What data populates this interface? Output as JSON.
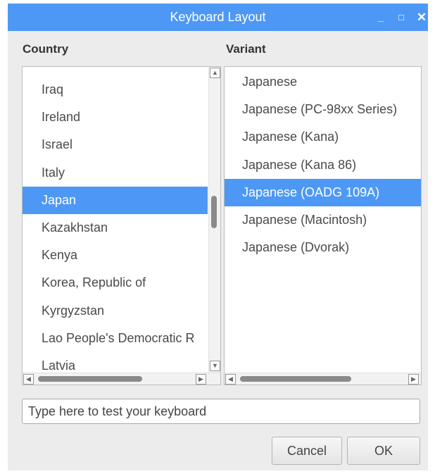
{
  "window": {
    "title": "Keyboard Layout",
    "minimize_glyph": "_",
    "maximize_glyph": "□",
    "close_glyph": "✕"
  },
  "country": {
    "label": "Country",
    "items": [
      "Iraq",
      "Ireland",
      "Israel",
      "Italy",
      "Japan",
      "Kazakhstan",
      "Kenya",
      "Korea, Republic of",
      "Kyrgyzstan",
      "Lao People's Democratic R",
      "Latvia"
    ],
    "selected_index": 4
  },
  "variant": {
    "label": "Variant",
    "items": [
      "Japanese",
      "Japanese (PC-98xx Series)",
      "Japanese (Kana)",
      "Japanese (Kana 86)",
      "Japanese (OADG 109A)",
      "Japanese (Macintosh)",
      "Japanese (Dvorak)"
    ],
    "selected_index": 4
  },
  "test_input": {
    "placeholder": "Type here to test your keyboard",
    "value": ""
  },
  "buttons": {
    "cancel": "Cancel",
    "ok": "OK"
  },
  "colors": {
    "accent": "#4d98f5",
    "dialog_bg": "#edecec"
  },
  "icons": {
    "scroll_up": "arrow-up-icon",
    "scroll_down": "arrow-down-icon",
    "scroll_left": "arrow-left-icon",
    "scroll_right": "arrow-right-icon"
  }
}
